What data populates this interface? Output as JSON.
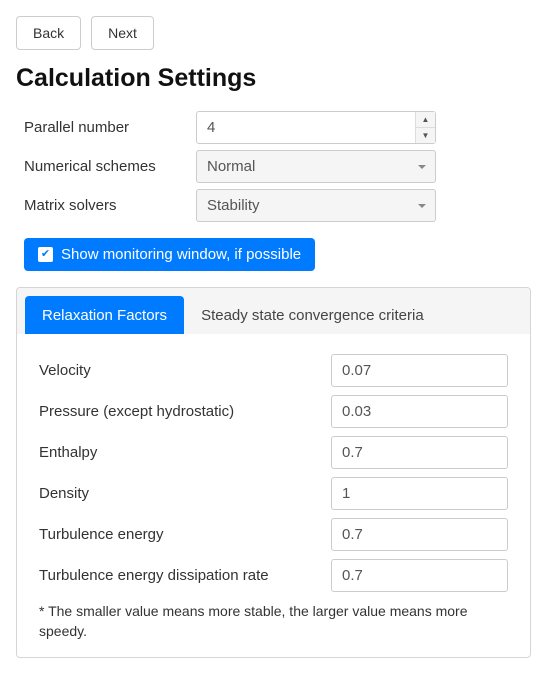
{
  "nav": {
    "back": "Back",
    "next": "Next"
  },
  "title": "Calculation Settings",
  "settings": {
    "parallel_label": "Parallel number",
    "parallel_value": "4",
    "schemes_label": "Numerical schemes",
    "schemes_value": "Normal",
    "solvers_label": "Matrix solvers",
    "solvers_value": "Stability"
  },
  "monitoring": {
    "label": "Show monitoring window, if possible",
    "checked": true
  },
  "tabs": {
    "relaxation": "Relaxation Factors",
    "steady": "Steady state convergence criteria"
  },
  "relaxation": {
    "velocity_label": "Velocity",
    "velocity_value": "0.07",
    "pressure_label": "Pressure (except hydrostatic)",
    "pressure_value": "0.03",
    "enthalpy_label": "Enthalpy",
    "enthalpy_value": "0.7",
    "density_label": "Density",
    "density_value": "1",
    "turb_energy_label": "Turbulence energy",
    "turb_energy_value": "0.7",
    "turb_diss_label": "Turbulence energy dissipation rate",
    "turb_diss_value": "0.7",
    "footnote": "* The smaller value means more stable, the larger value means more speedy."
  }
}
